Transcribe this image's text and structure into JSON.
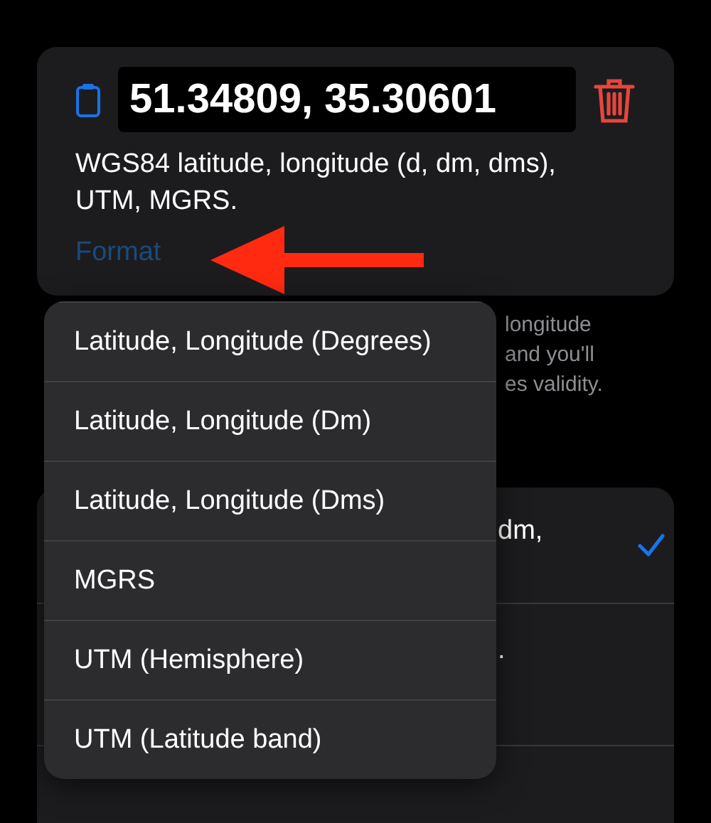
{
  "coordinate_card": {
    "value": "51.34809, 35.30601",
    "description": "WGS84 latitude, longitude (d, dm, dms), UTM, MGRS.",
    "format_link": "Format"
  },
  "footnote_lines": [
    "longitude",
    "and you'll",
    "es validity."
  ],
  "format_options": [
    {
      "label": "dm,",
      "selected": true
    },
    {
      "label": ".",
      "selected": false
    }
  ],
  "menu": [
    {
      "label": "Latitude, Longitude (Degrees)"
    },
    {
      "label": "Latitude, Longitude (Dm)"
    },
    {
      "label": "Latitude, Longitude (Dms)"
    },
    {
      "label": "MGRS"
    },
    {
      "label": "UTM (Hemisphere)"
    },
    {
      "label": "UTM (Latitude band)"
    }
  ]
}
